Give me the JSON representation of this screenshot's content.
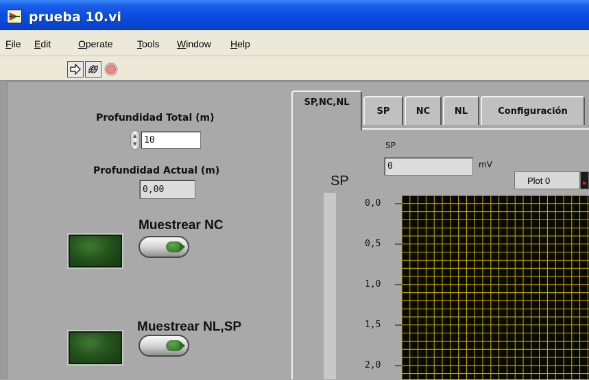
{
  "window": {
    "title": "prueba 10.vi",
    "title_bar_color": "#0a4ee0"
  },
  "menu": [
    {
      "accel": "F",
      "rest": "ile"
    },
    {
      "accel": "E",
      "rest": "dit"
    },
    {
      "accel": "O",
      "rest": "perate"
    },
    {
      "accel": "T",
      "rest": "ools"
    },
    {
      "accel": "W",
      "rest": "indow"
    },
    {
      "accel": "H",
      "rest": "elp"
    }
  ],
  "toolbar": {
    "buttons": [
      "run-arrow-icon",
      "run-continuously-icon",
      "abort-stop-icon"
    ]
  },
  "controls": {
    "profundidad_total": {
      "label": "Profundidad Total (m)",
      "value": "10"
    },
    "profundidad_actual": {
      "label": "Profundidad Actual (m)",
      "value": "0,00"
    },
    "muestrear_nc": {
      "label": "Muestrear NC"
    },
    "muestrear_nl_sp": {
      "label": "Muestrear NL,SP"
    }
  },
  "tabs": [
    {
      "label": "SP,NC,NL",
      "active": true
    },
    {
      "label": "SP",
      "active": false
    },
    {
      "label": "NC",
      "active": false
    },
    {
      "label": "NL",
      "active": false
    },
    {
      "label": "Configuración",
      "active": false
    }
  ],
  "sp_indicator": {
    "label": "SP",
    "value": "0",
    "unit": "mV"
  },
  "graph": {
    "title": "SP",
    "legend": "Plot 0",
    "y_ticks": [
      "0,0",
      "0,5",
      "1,0",
      "1,5",
      "2,0"
    ],
    "background": "#0a0a00",
    "grid_color": "#c8b400"
  }
}
